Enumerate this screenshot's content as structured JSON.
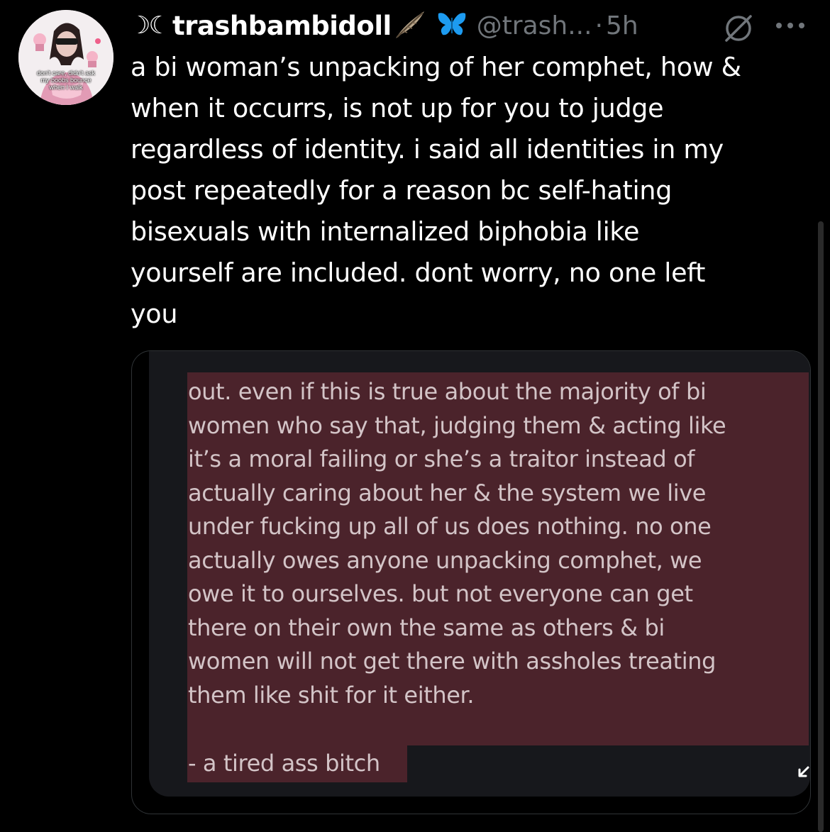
{
  "post": {
    "author": {
      "prefix_glyphs": "☽☾",
      "display_name": "trashbambidoll",
      "handle": "@trash...",
      "badge_icons": [
        "feather-icon",
        "butterfly-icon"
      ],
      "avatar_caption_lines": [
        "don't care, didn't ask",
        "my boobs bounce",
        "when I walk"
      ]
    },
    "separator": "·",
    "time": "5h",
    "text": "a bi woman’s unpacking of her comphet, how &\nwhen it occurrs, is not up for you to judge\nregardless of identity. i said all identities in my\npost repeatedly for a reason bc self-hating\nbisexuals with internalized biphobia like\nyourself are included. dont worry, no one left\nyou",
    "media": {
      "quote_text": "out. even if this is true about the majority of bi\nwomen who say that, judging them & acting like\nit’s a moral failing or she’s a traitor instead of\nactually caring about her & the system we live\nunder fucking up all of us does nothing. no one\nactually owes anyone unpacking comphet, we\nowe it to ourselves. but not everyone can get\nthere on their own the same as others & bi\nwomen will not get there with assholes treating\nthem like shit for it either.",
      "signoff": "- a tired ass bitch",
      "expand_icon": "expand-arrow-icon"
    }
  },
  "colors": {
    "background": "#000000",
    "text": "#ffffff",
    "muted": "#71767b",
    "highlight": "#4b232b",
    "card_border": "#2f3336",
    "butterfly": "#1d9bf0"
  }
}
